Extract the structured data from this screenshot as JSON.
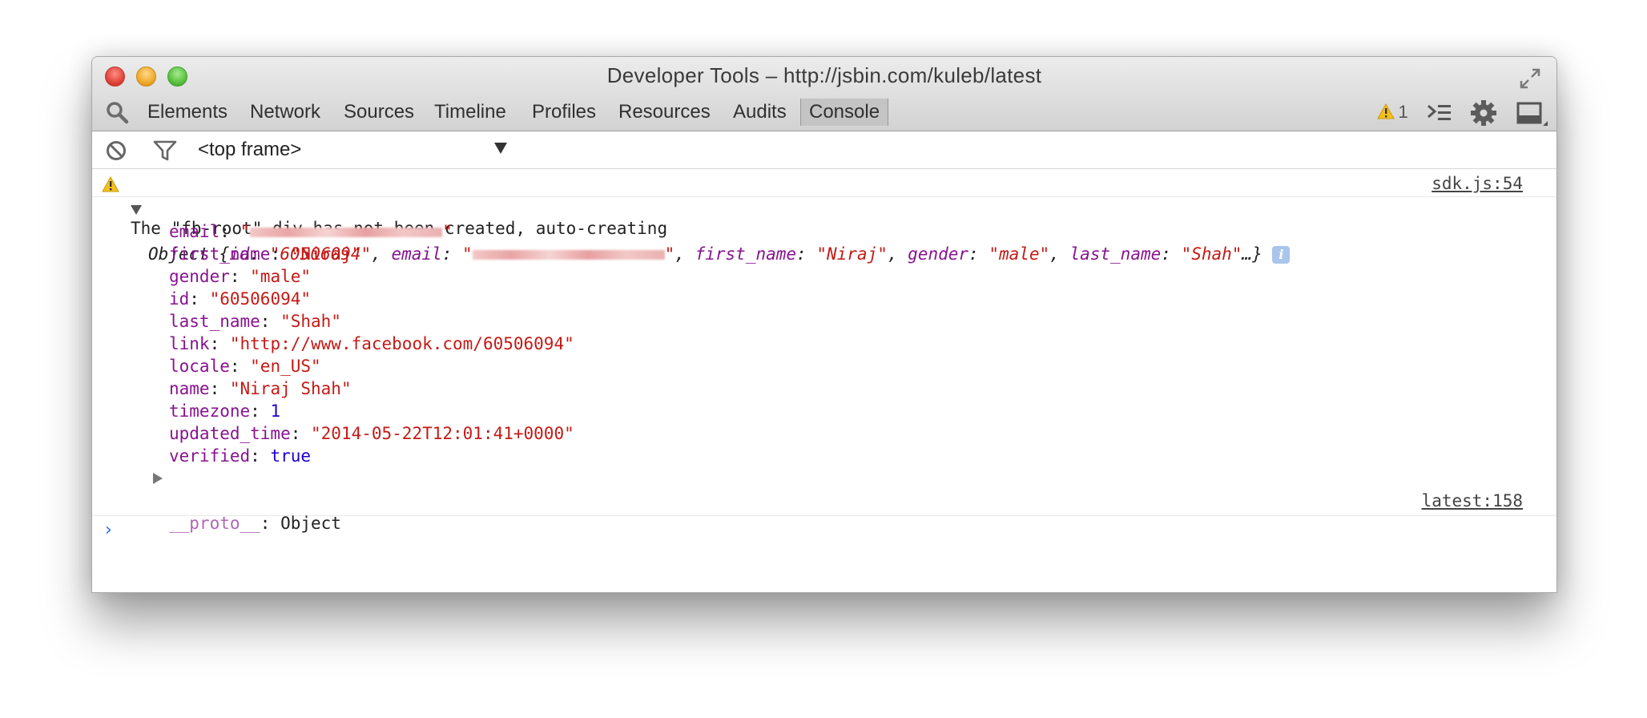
{
  "window": {
    "title": "Developer Tools – http://jsbin.com/kuleb/latest"
  },
  "tabs": [
    {
      "label": "Elements"
    },
    {
      "label": "Network"
    },
    {
      "label": "Sources"
    },
    {
      "label": "Timeline"
    },
    {
      "label": "Profiles"
    },
    {
      "label": "Resources"
    },
    {
      "label": "Audits"
    },
    {
      "label": "Console"
    }
  ],
  "toolbar_right": {
    "warning_count": "1",
    "icons": [
      "warning-icon",
      "show-drawer-icon",
      "settings-gear-icon",
      "dock-side-icon"
    ]
  },
  "console_toolbar": {
    "frame_select": "<top frame>",
    "icons": [
      "clear-console-icon",
      "filter-icon"
    ]
  },
  "messages": {
    "warning": {
      "text": "The \"fb-root\" div has not been created, auto-creating",
      "source": "sdk.js:54"
    },
    "object_log": {
      "summary_prefix": "Object {",
      "summary_id_key": "id",
      "summary_id_val": "\"60506094\"",
      "summary_email_key": "email",
      "summary_fn_key": "first_name",
      "summary_fn_val": "\"Niraj\"",
      "summary_gender_key": "gender",
      "summary_gender_val": "\"male\"",
      "summary_ln_key": "last_name",
      "summary_ln_val": "\"Shah\"",
      "summary_suffix": "…}",
      "properties": [
        {
          "key": "email",
          "value": "",
          "redacted": true
        },
        {
          "key": "first_name",
          "value": "\"Niraj\""
        },
        {
          "key": "gender",
          "value": "\"male\""
        },
        {
          "key": "id",
          "value": "\"60506094\""
        },
        {
          "key": "last_name",
          "value": "\"Shah\""
        },
        {
          "key": "link",
          "value": "\"http://www.facebook.com/60506094\""
        },
        {
          "key": "locale",
          "value": "\"en_US\""
        },
        {
          "key": "name",
          "value": "\"Niraj Shah\""
        },
        {
          "key": "timezone",
          "value": "1"
        },
        {
          "key": "updated_time",
          "value": "\"2014-05-22T12:01:41+0000\""
        },
        {
          "key": "verified",
          "value": "true"
        }
      ],
      "proto_key": "__proto__",
      "proto_value": "Object",
      "source": "latest:158"
    },
    "prompt_symbol": "›"
  },
  "colors": {
    "key_purple": "#881391",
    "string_red": "#c41a16",
    "number_blue": "#1c00cf",
    "prompt_blue": "#2e6bf0",
    "warning_yellow": "#f3c01c"
  }
}
